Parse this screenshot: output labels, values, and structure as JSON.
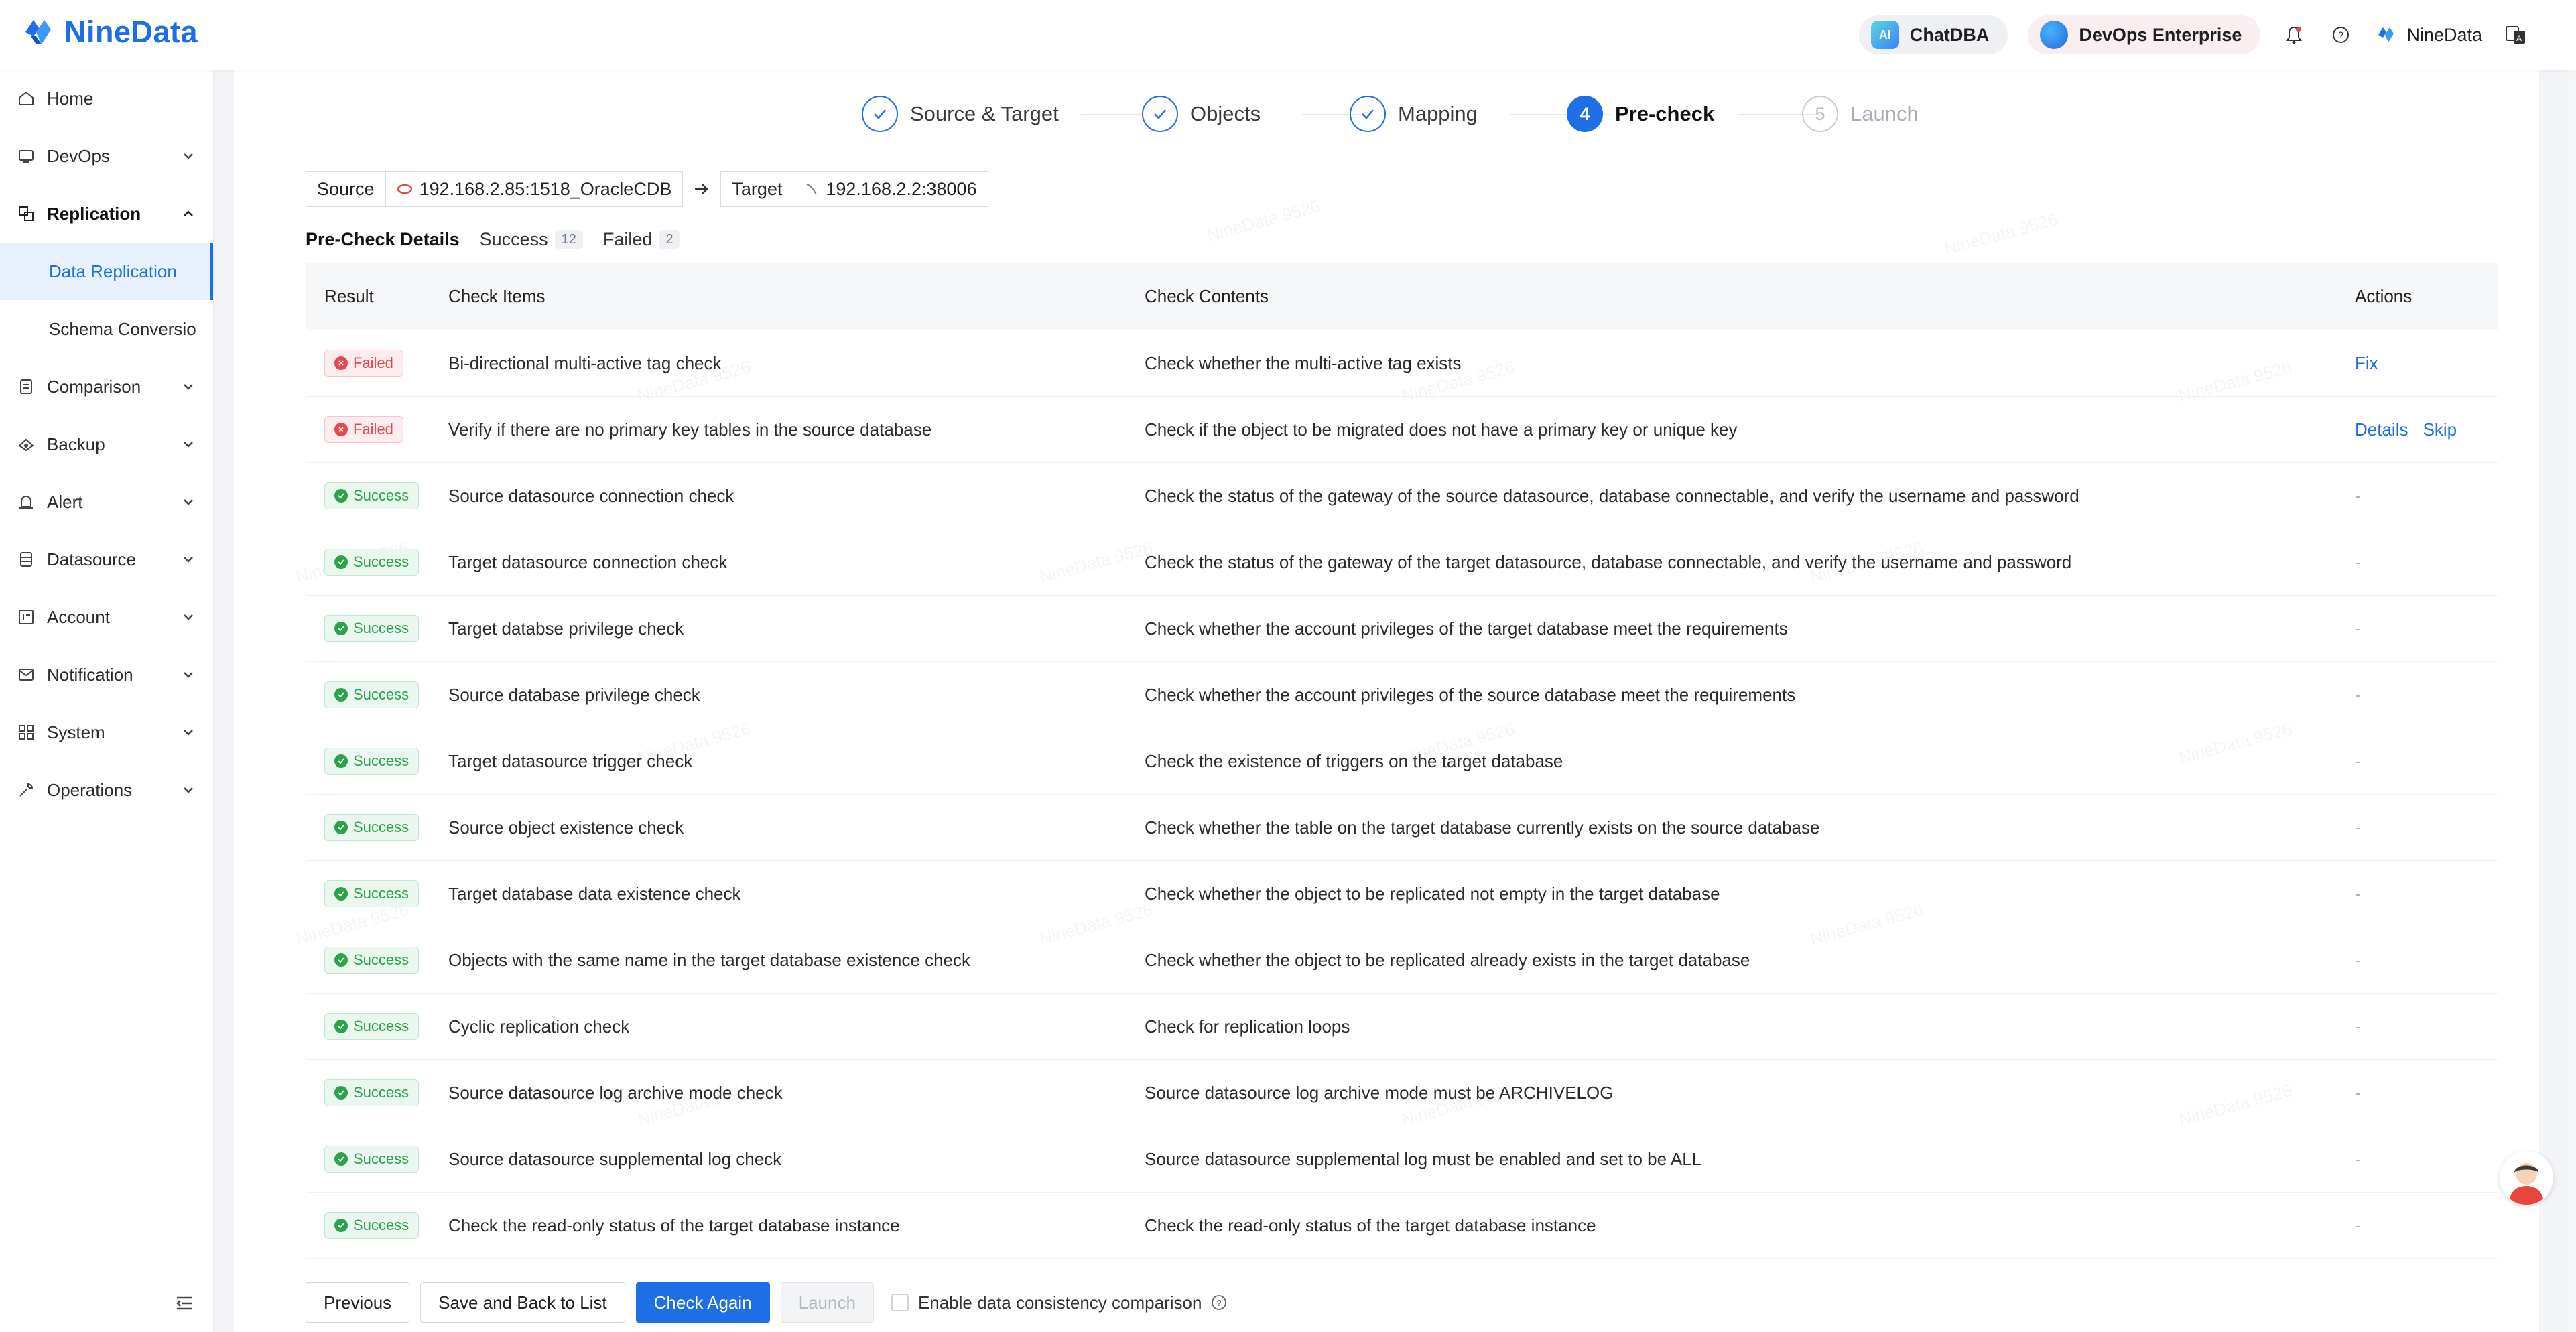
{
  "app": {
    "brand": "NineData",
    "watermark": "NineData 9526",
    "accent_color": "#1e6fe6",
    "failed_color": "#e5484d",
    "success_color": "#2aa34a"
  },
  "header": {
    "chatdba_label": "ChatDBA",
    "chatdba_icon_text": "AI",
    "devops_label": "DevOps Enterprise",
    "user_name": "NineData",
    "icons": [
      "bell-icon",
      "help-icon",
      "nine-data-user-icon",
      "language-icon"
    ]
  },
  "sidebar": {
    "items": [
      {
        "label": "Home",
        "icon": "home-icon"
      },
      {
        "label": "DevOps",
        "icon": "devops-icon"
      },
      {
        "label": "Replication",
        "icon": "replication-icon"
      },
      {
        "label": "Data Replication",
        "icon": ""
      },
      {
        "label": "Schema Conversio",
        "icon": ""
      },
      {
        "label": "Comparison",
        "icon": "comparison-icon"
      },
      {
        "label": "Backup",
        "icon": "backup-icon"
      },
      {
        "label": "Alert",
        "icon": "alert-icon"
      },
      {
        "label": "Datasource",
        "icon": "datasource-icon"
      },
      {
        "label": "Account",
        "icon": "account-icon"
      },
      {
        "label": "Notification",
        "icon": "notification-icon"
      },
      {
        "label": "System",
        "icon": "system-icon"
      },
      {
        "label": "Operations",
        "icon": "operations-icon"
      }
    ]
  },
  "steps": [
    {
      "label": "Source & Target",
      "state": "done"
    },
    {
      "label": "Objects",
      "state": "done"
    },
    {
      "label": "Mapping",
      "state": "done"
    },
    {
      "label": "Pre-check",
      "state": "current",
      "number": "4"
    },
    {
      "label": "Launch",
      "state": "todo",
      "number": "5"
    }
  ],
  "connection": {
    "source_label": "Source",
    "source_value": "192.168.2.85:1518_OracleCDB",
    "target_label": "Target",
    "target_value": "192.168.2.2:38006"
  },
  "tabs": {
    "title": "Pre-Check Details",
    "success_label": "Success",
    "success_count": "12",
    "failed_label": "Failed",
    "failed_count": "2"
  },
  "table": {
    "headers": [
      "Result",
      "Check Items",
      "Check Contents",
      "Actions"
    ],
    "rows": [
      {
        "result": "Failed",
        "item": "Bi-directional multi-active tag check",
        "content": "Check whether the multi-active tag exists",
        "actions": [
          "Fix"
        ]
      },
      {
        "result": "Failed",
        "item": "Verify if there are no primary key tables in the source database",
        "content": "Check if the object to be migrated does not have a primary key or unique key",
        "actions": [
          "Details",
          "Skip"
        ]
      },
      {
        "result": "Success",
        "item": "Source datasource connection check",
        "content": "Check the status of the gateway of the source datasource, database connectable, and verify the username and password",
        "actions": [
          "-"
        ]
      },
      {
        "result": "Success",
        "item": "Target datasource connection check",
        "content": "Check the status of the gateway of the target datasource, database connectable, and verify the username and password",
        "actions": [
          "-"
        ]
      },
      {
        "result": "Success",
        "item": "Target databse privilege check",
        "content": "Check whether the account privileges of the target database meet the requirements",
        "actions": [
          "-"
        ]
      },
      {
        "result": "Success",
        "item": "Source database privilege check",
        "content": "Check whether the account privileges of the source database meet the requirements",
        "actions": [
          "-"
        ]
      },
      {
        "result": "Success",
        "item": "Target datasource trigger check",
        "content": "Check the existence of triggers on the target database",
        "actions": [
          "-"
        ]
      },
      {
        "result": "Success",
        "item": "Source object existence check",
        "content": "Check whether the table on the target database currently exists on the source database",
        "actions": [
          "-"
        ]
      },
      {
        "result": "Success",
        "item": "Target database data existence check",
        "content": "Check whether the object to be replicated not empty in the target database",
        "actions": [
          "-"
        ]
      },
      {
        "result": "Success",
        "item": "Objects with the same name in the target database existence check",
        "content": "Check whether the object to be replicated already exists in the target database",
        "actions": [
          "-"
        ]
      },
      {
        "result": "Success",
        "item": "Cyclic replication check",
        "content": "Check for replication loops",
        "actions": [
          "-"
        ]
      },
      {
        "result": "Success",
        "item": "Source datasource log archive mode check",
        "content": "Source datasource log archive mode must be ARCHIVELOG",
        "actions": [
          "-"
        ]
      },
      {
        "result": "Success",
        "item": "Source datasource supplemental log check",
        "content": "Source datasource supplemental log must be enabled and set to be ALL",
        "actions": [
          "-"
        ]
      },
      {
        "result": "Success",
        "item": "Check the read-only status of the target database instance",
        "content": "Check the read-only status of the target database instance",
        "actions": [
          "-"
        ]
      }
    ]
  },
  "footer": {
    "previous": "Previous",
    "save_back": "Save and Back to List",
    "check_again": "Check Again",
    "launch": "Launch",
    "consistency_label": "Enable data consistency comparison"
  }
}
